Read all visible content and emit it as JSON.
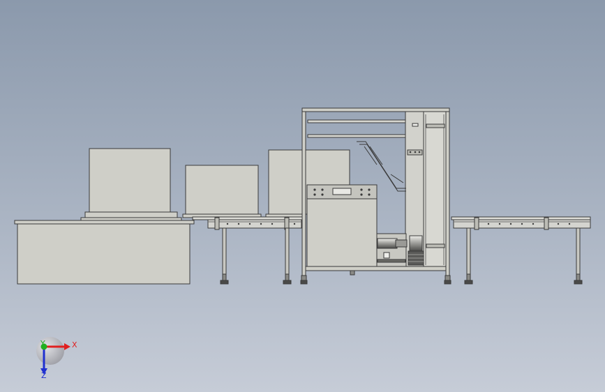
{
  "viewport": {
    "background_top": "#8b99ac",
    "background_bottom": "#c6ccd7"
  },
  "model": {
    "part_fill": "#cfcfc8",
    "edge_color": "#3a3a3a",
    "conveyor_fill": "#d4d4cf"
  },
  "triad": {
    "x_label": "X",
    "y_label": "Y",
    "z_label": "Z",
    "x_color": "#e02020",
    "y_color": "#20b020",
    "z_color": "#2030d0"
  }
}
